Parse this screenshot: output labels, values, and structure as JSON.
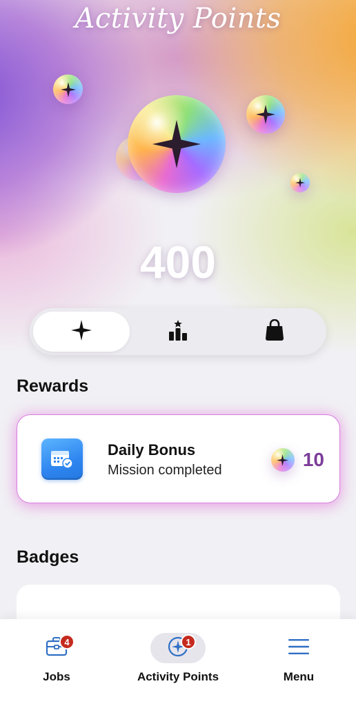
{
  "header": {
    "title": "Activity Points"
  },
  "points": {
    "value": "400"
  },
  "tabs": [
    {
      "icon": "sparkle-icon",
      "active": true
    },
    {
      "icon": "leaderboard-icon",
      "active": false
    },
    {
      "icon": "shopping-bag-icon",
      "active": false
    }
  ],
  "rewards": {
    "title": "Rewards",
    "items": [
      {
        "name": "Daily Bonus",
        "status": "Mission completed",
        "points": "10",
        "icon": "calendar-check-icon"
      }
    ]
  },
  "badges": {
    "title": "Badges"
  },
  "nav": {
    "items": [
      {
        "label": "Jobs",
        "icon": "briefcase-icon",
        "badge": "4",
        "active": false
      },
      {
        "label": "Activity Points",
        "icon": "sparkle-badge-icon",
        "badge": "1",
        "active": true
      },
      {
        "label": "Menu",
        "icon": "hamburger-icon",
        "badge": "",
        "active": false
      }
    ]
  },
  "colors": {
    "accent": "#7b3d99",
    "reward_border": "#d77ee0",
    "notification": "#c52a1f",
    "icon_blue": "#2f86f0"
  }
}
